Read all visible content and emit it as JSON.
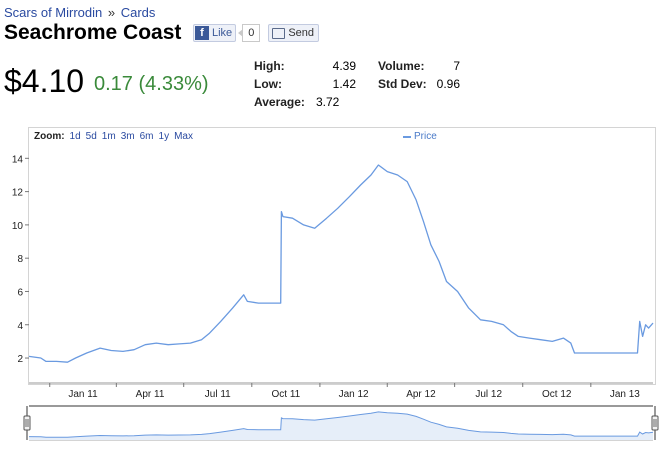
{
  "breadcrumb": {
    "set": "Scars of Mirrodin",
    "separator": "»",
    "section": "Cards"
  },
  "title": "Seachrome Coast",
  "social": {
    "like_label": "Like",
    "like_count": "0",
    "send_label": "Send",
    "fb_glyph": "f"
  },
  "price": {
    "current": "$4.10",
    "change": "0.17 (4.33%)",
    "change_color": "#3a8a3a"
  },
  "stats": {
    "high": {
      "label": "High:",
      "value": "4.39"
    },
    "low": {
      "label": "Low:",
      "value": "1.42"
    },
    "average": {
      "label": "Average:",
      "value": "3.72"
    },
    "volume": {
      "label": "Volume:",
      "value": "7"
    },
    "std_dev": {
      "label": "Std Dev:",
      "value": "0.96"
    }
  },
  "zoom": {
    "label": "Zoom:",
    "options": [
      "1d",
      "5d",
      "1m",
      "3m",
      "6m",
      "1y",
      "Max"
    ]
  },
  "chart_data": {
    "type": "line",
    "series": [
      {
        "name": "Price",
        "color": "#6a9ae0"
      }
    ],
    "x_ticks": [
      "Jan 11",
      "Apr 11",
      "Jul 11",
      "Oct 11",
      "Jan 12",
      "Apr 12",
      "Jul 12",
      "Oct 12",
      "Jan 13"
    ],
    "y_ticks": [
      2,
      4,
      6,
      8,
      10,
      12,
      14
    ],
    "ylim": [
      0.5,
      14.5
    ],
    "xlim": [
      "2010-12-04",
      "2013-03-26"
    ],
    "grid": "horizontal-ticks",
    "legend": "top",
    "points": [
      [
        "2010-12-04",
        2.1
      ],
      [
        "2010-12-20",
        2.0
      ],
      [
        "2010-12-27",
        1.8
      ],
      [
        "2011-01-10",
        1.8
      ],
      [
        "2011-01-25",
        1.75
      ],
      [
        "2011-02-05",
        2.0
      ],
      [
        "2011-02-20",
        2.3
      ],
      [
        "2011-03-10",
        2.6
      ],
      [
        "2011-03-25",
        2.45
      ],
      [
        "2011-04-10",
        2.4
      ],
      [
        "2011-04-25",
        2.5
      ],
      [
        "2011-05-10",
        2.8
      ],
      [
        "2011-05-25",
        2.9
      ],
      [
        "2011-06-10",
        2.8
      ],
      [
        "2011-06-25",
        2.85
      ],
      [
        "2011-07-10",
        2.9
      ],
      [
        "2011-07-25",
        3.1
      ],
      [
        "2011-08-05",
        3.5
      ],
      [
        "2011-08-20",
        4.2
      ],
      [
        "2011-09-05",
        5.0
      ],
      [
        "2011-09-20",
        5.8
      ],
      [
        "2011-09-25",
        5.4
      ],
      [
        "2011-10-10",
        5.3
      ],
      [
        "2011-10-25",
        5.3
      ],
      [
        "2011-11-09",
        5.3
      ],
      [
        "2011-11-10",
        10.8
      ],
      [
        "2011-11-12",
        10.5
      ],
      [
        "2011-11-25",
        10.4
      ],
      [
        "2011-12-10",
        10.0
      ],
      [
        "2011-12-25",
        9.8
      ],
      [
        "2012-01-10",
        10.4
      ],
      [
        "2012-01-25",
        11.0
      ],
      [
        "2012-02-10",
        11.7
      ],
      [
        "2012-02-25",
        12.4
      ],
      [
        "2012-03-10",
        13.0
      ],
      [
        "2012-03-20",
        13.6
      ],
      [
        "2012-04-01",
        13.2
      ],
      [
        "2012-04-15",
        13.0
      ],
      [
        "2012-04-28",
        12.6
      ],
      [
        "2012-05-10",
        11.5
      ],
      [
        "2012-05-20",
        10.2
      ],
      [
        "2012-05-30",
        8.8
      ],
      [
        "2012-06-10",
        7.8
      ],
      [
        "2012-06-20",
        6.6
      ],
      [
        "2012-07-05",
        6.0
      ],
      [
        "2012-07-20",
        5.0
      ],
      [
        "2012-08-05",
        4.3
      ],
      [
        "2012-08-20",
        4.2
      ],
      [
        "2012-09-05",
        4.0
      ],
      [
        "2012-09-15",
        3.6
      ],
      [
        "2012-09-25",
        3.3
      ],
      [
        "2012-10-10",
        3.2
      ],
      [
        "2012-10-25",
        3.1
      ],
      [
        "2012-11-10",
        3.0
      ],
      [
        "2012-11-25",
        3.2
      ],
      [
        "2012-12-05",
        2.9
      ],
      [
        "2012-12-10",
        2.3
      ],
      [
        "2012-12-25",
        2.3
      ],
      [
        "2013-01-15",
        2.3
      ],
      [
        "2013-02-05",
        2.3
      ],
      [
        "2013-02-25",
        2.3
      ],
      [
        "2013-03-05",
        2.3
      ],
      [
        "2013-03-08",
        4.2
      ],
      [
        "2013-03-12",
        3.3
      ],
      [
        "2013-03-16",
        4.0
      ],
      [
        "2013-03-20",
        3.8
      ],
      [
        "2013-03-26",
        4.1
      ]
    ]
  }
}
